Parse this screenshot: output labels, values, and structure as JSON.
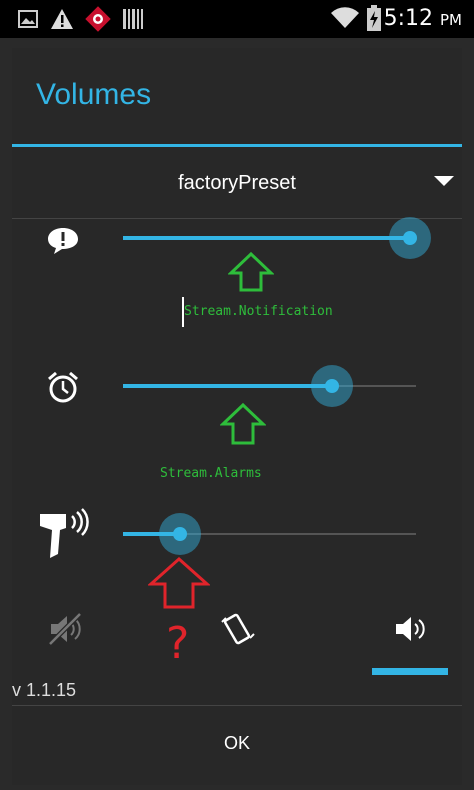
{
  "status_bar": {
    "time": "5:12",
    "ampm": "PM",
    "icons": [
      "gallery-icon",
      "warning-icon",
      "alert-app-icon",
      "barcode-icon",
      "wifi-icon",
      "battery-charging-icon"
    ]
  },
  "dialog": {
    "title": "Volumes",
    "preset": "factoryPreset",
    "streams": [
      {
        "icon": "notification-icon",
        "value": 0.99,
        "annotation": "Stream.Notification"
      },
      {
        "icon": "alarm-clock-icon",
        "value": 0.71,
        "annotation": "Stream.Alarms"
      },
      {
        "icon": "scanner-beep-icon",
        "value": 0.19,
        "annotation": ""
      }
    ],
    "question_mark": "?",
    "ringer_modes": [
      "mute-icon",
      "vibrate-icon",
      "sound-on-icon"
    ],
    "selected_mode": "sound-on-icon",
    "version": "v 1.1.15",
    "ok_label": "OK"
  },
  "colors": {
    "accent": "#33b5e5",
    "annotation_arrow_green": "#2ebd3b",
    "annotation_arrow_red": "#e0242b"
  }
}
